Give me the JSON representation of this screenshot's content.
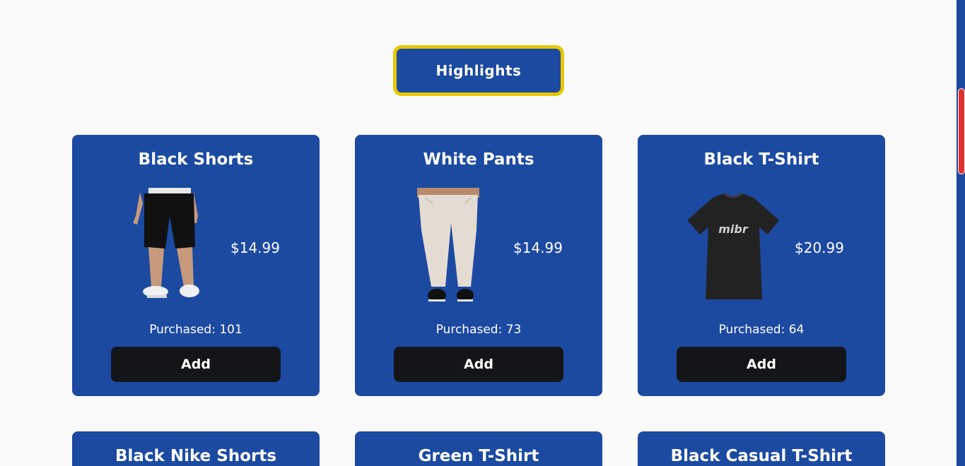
{
  "section": {
    "highlights_label": "Highlights"
  },
  "products": [
    {
      "name": "Black Shorts",
      "price": "$14.99",
      "purchased": "Purchased: 101",
      "add_label": "Add",
      "image_icon": "black-shorts-image"
    },
    {
      "name": "White Pants",
      "price": "$14.99",
      "purchased": "Purchased: 73",
      "add_label": "Add",
      "image_icon": "white-pants-image"
    },
    {
      "name": "Black T-Shirt",
      "price": "$20.99",
      "purchased": "Purchased: 64",
      "add_label": "Add",
      "image_icon": "black-tshirt-image",
      "print": "mibr"
    }
  ],
  "more_products": [
    {
      "name": "Black Nike Shorts"
    },
    {
      "name": "Green T-Shirt"
    },
    {
      "name": "Black Casual T-Shirt"
    }
  ],
  "colors": {
    "brand_blue": "#1c4aa1",
    "highlight_border": "#e6c800",
    "button_dark": "#141518",
    "scroll_thumb": "#e03131"
  }
}
